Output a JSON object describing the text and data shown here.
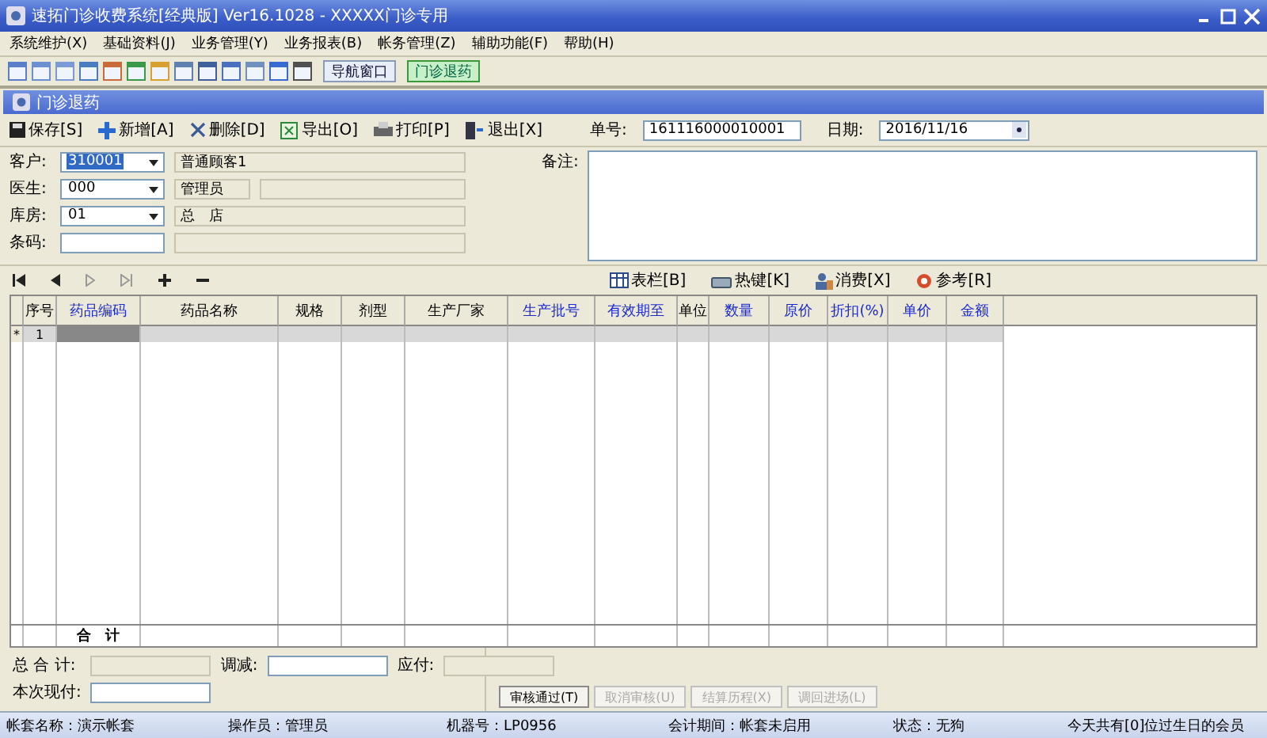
{
  "window": {
    "title": "速拓门诊收费系统[经典版] Ver16.1028  -  XXXXX门诊专用"
  },
  "menu": [
    "系统维护(X)",
    "基础资料(J)",
    "业务管理(Y)",
    "业务报表(B)",
    "帐务管理(Z)",
    "辅助功能(F)",
    "帮助(H)"
  ],
  "quick_tabs": [
    {
      "label": "导航窗口",
      "selected": false
    },
    {
      "label": "门诊退药",
      "selected": true
    }
  ],
  "child_window": {
    "title": "门诊退药"
  },
  "actions": [
    {
      "kind": "save",
      "label": "保存[S]"
    },
    {
      "kind": "add",
      "label": "新增[A]"
    },
    {
      "kind": "delete",
      "label": "删除[D]"
    },
    {
      "kind": "export",
      "label": "导出[O]"
    },
    {
      "kind": "print",
      "label": "打印[P]"
    },
    {
      "kind": "exit",
      "label": "退出[X]"
    }
  ],
  "order_no": {
    "label": "单号:",
    "value": "161116000010001"
  },
  "date": {
    "label": "日期:",
    "value": "2016/11/16"
  },
  "form": [
    {
      "kind": "lookup",
      "label": "客户:",
      "code": "310001",
      "name": "普通顾客1",
      "highlighted": true
    },
    {
      "kind": "split",
      "label": "医生:",
      "code": "000",
      "name": "管理员",
      "highlighted": false
    },
    {
      "kind": "lookup",
      "label": "库房:",
      "code": "01",
      "name": "总　店",
      "highlighted": false
    },
    {
      "kind": "plain",
      "label": "条码:"
    }
  ],
  "remark": {
    "label": "备注:"
  },
  "grid_tools": [
    {
      "kind": "table",
      "label": "表栏[B]"
    },
    {
      "kind": "hotkey",
      "label": "热键[K]"
    },
    {
      "kind": "consume",
      "label": "消费[X]"
    },
    {
      "kind": "reference",
      "label": "参考[R]"
    }
  ],
  "table": {
    "columns": [
      {
        "label": "序号",
        "editable": false
      },
      {
        "label": "药品编码",
        "editable": true
      },
      {
        "label": "药品名称",
        "editable": false
      },
      {
        "label": "规格",
        "editable": false
      },
      {
        "label": "剂型",
        "editable": false
      },
      {
        "label": "生产厂家",
        "editable": false
      },
      {
        "label": "生产批号",
        "editable": true
      },
      {
        "label": "有效期至",
        "editable": true
      },
      {
        "label": "单位",
        "editable": false
      },
      {
        "label": "数量",
        "editable": true
      },
      {
        "label": "原价",
        "editable": true
      },
      {
        "label": "折扣(%)",
        "editable": true
      },
      {
        "label": "单价",
        "editable": true
      },
      {
        "label": "金额",
        "editable": true
      }
    ],
    "new_row": {
      "marker": "*",
      "number": "1"
    },
    "total_label": "合　计"
  },
  "totals": [
    {
      "label": "总 合 计:"
    },
    {
      "label": "调减:"
    },
    {
      "label": "应付:"
    },
    {
      "label": "本次现付:"
    }
  ],
  "bottom_buttons": [
    {
      "label": "审核通过(T)",
      "disabled": false
    },
    {
      "label": "取消审核(U)",
      "disabled": true
    },
    {
      "label": "结算历程(X)",
      "disabled": true
    },
    {
      "label": "调回进场(L)",
      "disabled": true
    }
  ],
  "status_bar": [
    "帐套名称：演示帐套",
    "操作员：管理员",
    "机器号：LP0956",
    "会计期间：帐套未启用",
    "状态：无狗",
    "今天共有[0]位过生日的会员"
  ]
}
